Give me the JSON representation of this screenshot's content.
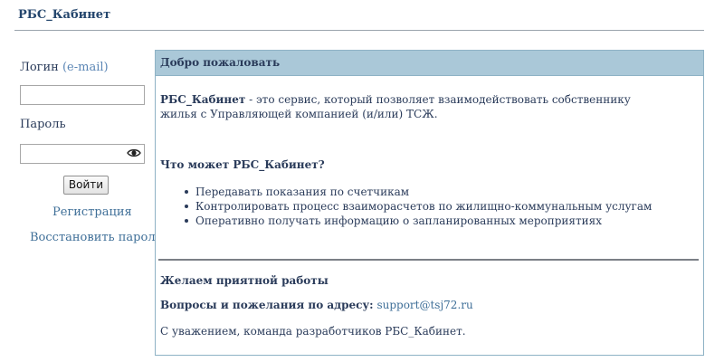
{
  "header": {
    "brand": "РБС_Кабинет"
  },
  "login": {
    "login_label": "Логин",
    "login_hint": "(e-mail)",
    "login_value": "",
    "password_label": "Пароль",
    "password_value": "",
    "submit_label": "Войти",
    "register_link": "Регистрация",
    "restore_link": "Восстановить пароль"
  },
  "welcome": {
    "title": "Добро пожаловать",
    "intro_brand": "РБС_Кабинет",
    "intro_text": " - это сервис, который позволяет взаимодействовать собственнику жилья с Управляющей компанией (и/или) ТСЖ.",
    "features_title": "Что может РБС_Кабинет?",
    "features": [
      "Передавать показания по счетчикам",
      "Контролировать процесс взаиморасчетов по жилищно-коммунальным услугам",
      "Оперативно получать информацию о запланированных мероприятиях"
    ],
    "wishes": "Желаем приятной работы",
    "contact_label": "Вопросы и пожелания по адресу:",
    "contact_email": "support@tsj72.ru",
    "regards": "С уважением, команда разработчиков РБС_Кабинет."
  },
  "colors": {
    "panel_header_bg": "#aac8d8",
    "link": "#3f6f98",
    "text": "#2a3b5a"
  },
  "icons": {
    "password_toggle": "eye-icon"
  }
}
